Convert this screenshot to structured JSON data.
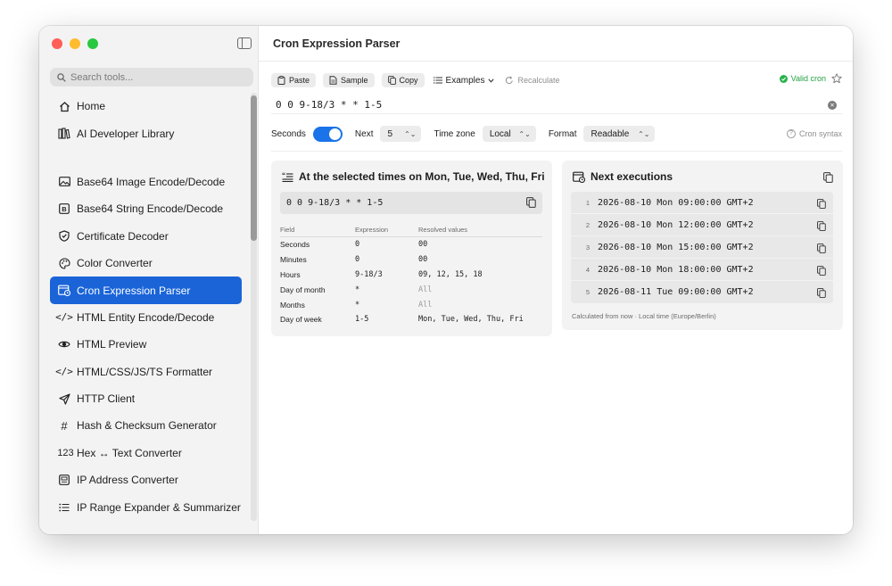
{
  "window": {
    "traffic_colors": {
      "close": "#ff5f57",
      "minimize": "#febc2e",
      "zoom": "#28c840"
    }
  },
  "sidebar": {
    "search_placeholder": "Search tools...",
    "items_top": [
      {
        "label": "Home",
        "icon": "house-icon"
      },
      {
        "label": "AI Developer Library",
        "icon": "books-icon"
      }
    ],
    "items": [
      {
        "label": "Base64 Image Encode/Decode",
        "icon": "photo-icon"
      },
      {
        "label": "Base64 String Encode/Decode",
        "icon": "b-box-icon"
      },
      {
        "label": "Certificate Decoder",
        "icon": "shield-check-icon"
      },
      {
        "label": "Color Converter",
        "icon": "palette-icon"
      },
      {
        "label": "Cron Expression Parser",
        "icon": "calendar-clock-icon",
        "active": true
      },
      {
        "label": "HTML Entity Encode/Decode",
        "icon": "code-brackets-icon"
      },
      {
        "label": "HTML Preview",
        "icon": "eye-icon"
      },
      {
        "label": "HTML/CSS/JS/TS Formatter",
        "icon": "code-brackets-icon"
      },
      {
        "label": "HTTP Client",
        "icon": "paper-plane-icon"
      },
      {
        "label": "Hash & Checksum Generator",
        "icon": "hash-icon"
      },
      {
        "label": "Hex ↔ Text Converter",
        "icon": "numbers-icon"
      },
      {
        "label": "IP Address Converter",
        "icon": "ip-box-icon"
      },
      {
        "label": "IP Range Expander & Summarizer",
        "icon": "list-icon"
      }
    ],
    "accent": "#1a64d8"
  },
  "main": {
    "title": "Cron Expression Parser",
    "toolbar": {
      "paste": "Paste",
      "sample": "Sample",
      "copy": "Copy",
      "examples": "Examples",
      "recalculate": "Recalculate",
      "status": "Valid cron",
      "status_color": "#25a244"
    },
    "expression": "0 0 9-18/3 * * 1-5",
    "options": {
      "seconds_label": "Seconds",
      "seconds_on": true,
      "next_label": "Next",
      "next_value": "5",
      "timezone_label": "Time zone",
      "timezone_value": "Local",
      "format_label": "Format",
      "format_value": "Readable",
      "help_label": "Cron syntax"
    },
    "summary": {
      "title": "At the selected times on Mon, Tue, Wed, Thu, Fri",
      "expression": "0 0 9-18/3 * * 1-5",
      "headers": [
        "Field",
        "Expression",
        "Resolved values"
      ],
      "rows": [
        {
          "field": "Seconds",
          "expr": "0",
          "values": "00",
          "dim": false
        },
        {
          "field": "Minutes",
          "expr": "0",
          "values": "00",
          "dim": false
        },
        {
          "field": "Hours",
          "expr": "9-18/3",
          "values": "09, 12, 15, 18",
          "dim": false
        },
        {
          "field": "Day of month",
          "expr": "*",
          "values": "All",
          "dim": true
        },
        {
          "field": "Months",
          "expr": "*",
          "values": "All",
          "dim": true
        },
        {
          "field": "Day of week",
          "expr": "1-5",
          "values": "Mon, Tue, Wed, Thu, Fri",
          "dim": false
        }
      ]
    },
    "executions": {
      "title": "Next executions",
      "items": [
        {
          "n": "1",
          "value": "2026-08-10 Mon 09:00:00 GMT+2"
        },
        {
          "n": "2",
          "value": "2026-08-10 Mon 12:00:00 GMT+2"
        },
        {
          "n": "3",
          "value": "2026-08-10 Mon 15:00:00 GMT+2"
        },
        {
          "n": "4",
          "value": "2026-08-10 Mon 18:00:00 GMT+2"
        },
        {
          "n": "5",
          "value": "2026-08-11 Tue 09:00:00 GMT+2"
        }
      ],
      "footnote": "Calculated from now · Local time (Europe/Berlin)"
    }
  }
}
